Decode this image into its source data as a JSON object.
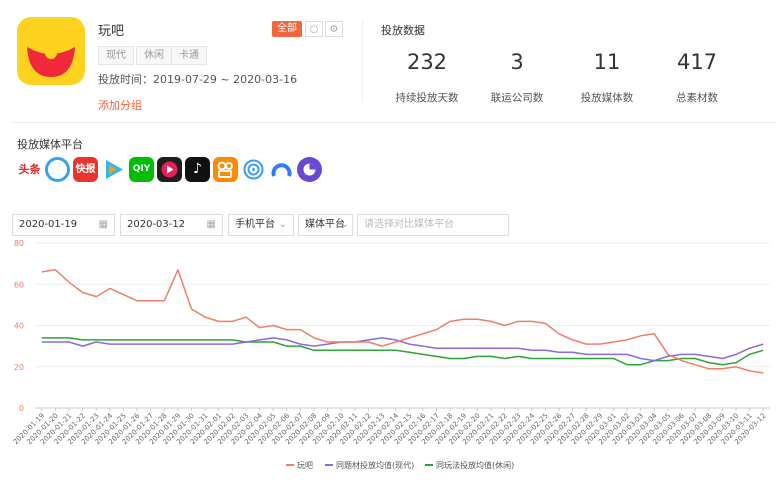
{
  "app": {
    "name": "玩吧",
    "tags": [
      "现代",
      "休闲",
      "卡通"
    ],
    "period": "投放时间：2019-07-29 ~ 2020-03-16",
    "add_group": "添加分组",
    "filter_all": "全部",
    "os_icons": [
      "apple-icon",
      "android-icon"
    ]
  },
  "stats": {
    "title": "投放数据",
    "items": [
      {
        "value": "232",
        "label": "持续投放天数"
      },
      {
        "value": "3",
        "label": "联运公司数"
      },
      {
        "value": "11",
        "label": "投放媒体数"
      },
      {
        "value": "417",
        "label": "总素材数"
      }
    ]
  },
  "platforms": {
    "title": "投放媒体平台",
    "icons": [
      "toutiao-icon",
      "tencent-news-icon",
      "kuaikan-icon",
      "tencent-video-icon",
      "iqiyi-icon",
      "youku-icon",
      "douyin-icon",
      "kuaishou-icon",
      "wifi-master-icon",
      "baidu-icon",
      "qq-browser-icon"
    ],
    "toutiao_text": "头条",
    "kuaikan_text": "快报",
    "iqiyi_text": "QIY"
  },
  "filters": {
    "start_date": "2020-01-19",
    "end_date": "2020-03-12",
    "device": "手机平台",
    "media": "媒体平台",
    "compare_placeholder": "请选择对比媒体平台"
  },
  "colors": {
    "accent": "#f0663f",
    "series_1": "#f07f6a",
    "series_2": "#8d6ad6",
    "series_3": "#2ea33a"
  },
  "chart_data": {
    "type": "line",
    "ylim": [
      0,
      80
    ],
    "yticks": [
      0,
      20,
      40,
      60,
      80
    ],
    "x": [
      "2020-01-19",
      "2020-01-20",
      "2020-01-21",
      "2020-01-22",
      "2020-01-23",
      "2020-01-24",
      "2020-01-25",
      "2020-01-26",
      "2020-01-27",
      "2020-01-28",
      "2020-01-29",
      "2020-01-30",
      "2020-01-31",
      "2020-02-01",
      "2020-02-02",
      "2020-02-03",
      "2020-02-04",
      "2020-02-05",
      "2020-02-06",
      "2020-02-07",
      "2020-02-08",
      "2020-02-09",
      "2020-02-10",
      "2020-02-11",
      "2020-02-12",
      "2020-02-13",
      "2020-02-14",
      "2020-02-15",
      "2020-02-16",
      "2020-02-17",
      "2020-02-18",
      "2020-02-19",
      "2020-02-20",
      "2020-02-21",
      "2020-02-22",
      "2020-02-23",
      "2020-02-24",
      "2020-02-25",
      "2020-02-26",
      "2020-02-27",
      "2020-02-28",
      "2020-02-29",
      "2020-03-01",
      "2020-03-02",
      "2020-03-03",
      "2020-03-04",
      "2020-03-05",
      "2020-03-06",
      "2020-03-07",
      "2020-03-08",
      "2020-03-09",
      "2020-03-10",
      "2020-03-11",
      "2020-03-12"
    ],
    "series": [
      {
        "name": "玩吧",
        "color": "#f07f6a",
        "values": [
          66,
          67,
          61,
          56,
          54,
          58,
          55,
          52,
          52,
          52,
          67,
          48,
          44,
          42,
          42,
          44,
          39,
          40,
          38,
          38,
          34,
          32,
          32,
          32,
          32,
          30,
          32,
          34,
          36,
          38,
          42,
          43,
          43,
          42,
          40,
          42,
          42,
          41,
          36,
          33,
          31,
          31,
          32,
          33,
          35,
          36,
          26,
          23,
          21,
          19,
          19,
          20,
          18,
          17
        ]
      },
      {
        "name": "同题材投放均值(现代)",
        "color": "#8d6ad6",
        "values": [
          32,
          32,
          32,
          30,
          32,
          31,
          31,
          31,
          31,
          31,
          31,
          31,
          31,
          31,
          31,
          32,
          33,
          34,
          33,
          31,
          30,
          31,
          32,
          32,
          33,
          34,
          33,
          31,
          30,
          29,
          29,
          29,
          29,
          29,
          29,
          29,
          28,
          28,
          27,
          27,
          26,
          26,
          26,
          26,
          24,
          23,
          25,
          26,
          26,
          25,
          24,
          26,
          29,
          31
        ]
      },
      {
        "name": "同玩法投放均值(休闲)",
        "color": "#2ea33a",
        "values": [
          34,
          34,
          34,
          33,
          33,
          33,
          33,
          33,
          33,
          33,
          33,
          33,
          33,
          33,
          33,
          32,
          32,
          32,
          30,
          30,
          28,
          28,
          28,
          28,
          28,
          28,
          28,
          27,
          26,
          25,
          24,
          24,
          25,
          25,
          24,
          25,
          24,
          24,
          24,
          24,
          24,
          24,
          24,
          21,
          21,
          23,
          23,
          24,
          24,
          22,
          21,
          22,
          26,
          28
        ]
      }
    ]
  }
}
